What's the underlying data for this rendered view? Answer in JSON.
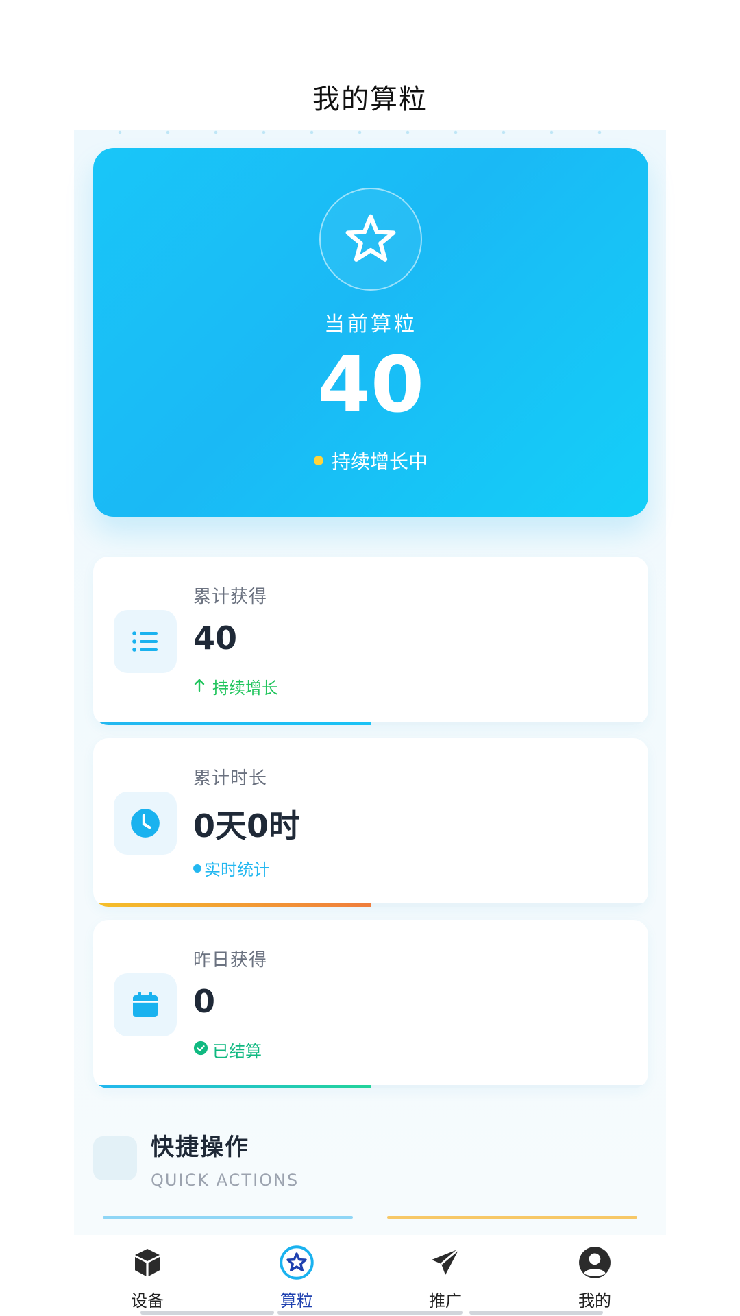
{
  "header": {
    "title": "我的算粒"
  },
  "hero": {
    "label": "当前算粒",
    "value": "40",
    "status": "持续增长中",
    "icon": "star-icon"
  },
  "stats": [
    {
      "label": "累计获得",
      "value": "40",
      "sub": "持续增长",
      "sub_icon": "arrow-up-icon",
      "icon": "list-icon",
      "progress": 0.5,
      "sub_color": "#22c55e",
      "bar_color": "#22b7f0"
    },
    {
      "label": "累计时长",
      "value": "0天0时",
      "sub": "实时统计",
      "sub_icon": "dot-icon",
      "icon": "clock-icon",
      "progress": 0.5,
      "sub_color": "#22b7f0",
      "bar_color": "#f5a623"
    },
    {
      "label": "昨日获得",
      "value": "0",
      "sub": "已结算",
      "sub_icon": "check-circle-icon",
      "icon": "calendar-icon",
      "progress": 0.5,
      "sub_color": "#10b981",
      "bar_color": "#22c3a8"
    }
  ],
  "quick_actions": {
    "title": "快捷操作",
    "subtitle": "QUICK ACTIONS"
  },
  "bottom_nav": [
    {
      "label": "设备",
      "icon": "cube-icon",
      "active": false
    },
    {
      "label": "算粒",
      "icon": "star-circle-icon",
      "active": true
    },
    {
      "label": "推广",
      "icon": "paper-plane-icon",
      "active": false
    },
    {
      "label": "我的",
      "icon": "user-icon",
      "active": false
    }
  ],
  "colors": {
    "accent": "#1ab9f5",
    "active_nav": "#1e40af",
    "status_dot": "#ffd43b"
  }
}
